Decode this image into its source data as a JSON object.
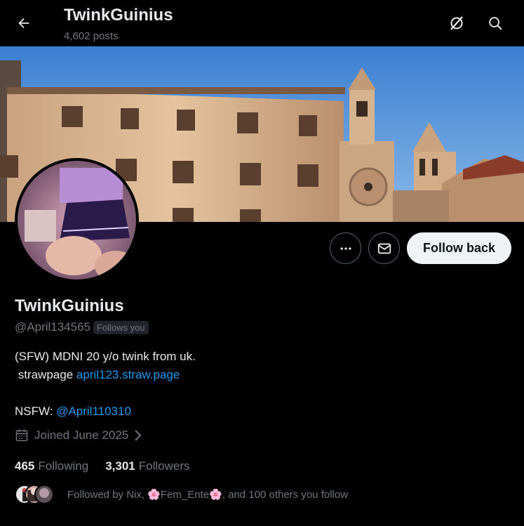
{
  "header": {
    "title": "TwinkGuinius",
    "posts": "4,602 posts",
    "back_icon": "arrow-left-icon",
    "grok_icon": "grok-icon",
    "search_icon": "search-icon"
  },
  "profile": {
    "name": "TwinkGuinius",
    "handle": "@April134565",
    "follows_you": "Follows you",
    "bio": {
      "line1": "(SFW) MDNI 20 y/o twink from uk.",
      "line2_prefix": " strawpage ",
      "line2_link": "april123.straw.page",
      "line4_prefix": "NSFW: ",
      "line4_link": "@April110310"
    },
    "joined": "Joined June 2025",
    "following_count": "465",
    "following_label": "Following",
    "followers_count": "3,301",
    "followers_label": "Followers",
    "followed_by": "Followed by Nix, 🌸Fem_Ente🌸, and 100 others you follow"
  },
  "actions": {
    "follow_back": "Follow back",
    "more_icon": "more-icon",
    "message_icon": "mail-icon"
  },
  "colors": {
    "background": "#000000",
    "link": "#1d9bf0",
    "muted": "#71767b",
    "button_bg": "#eff3f4"
  }
}
